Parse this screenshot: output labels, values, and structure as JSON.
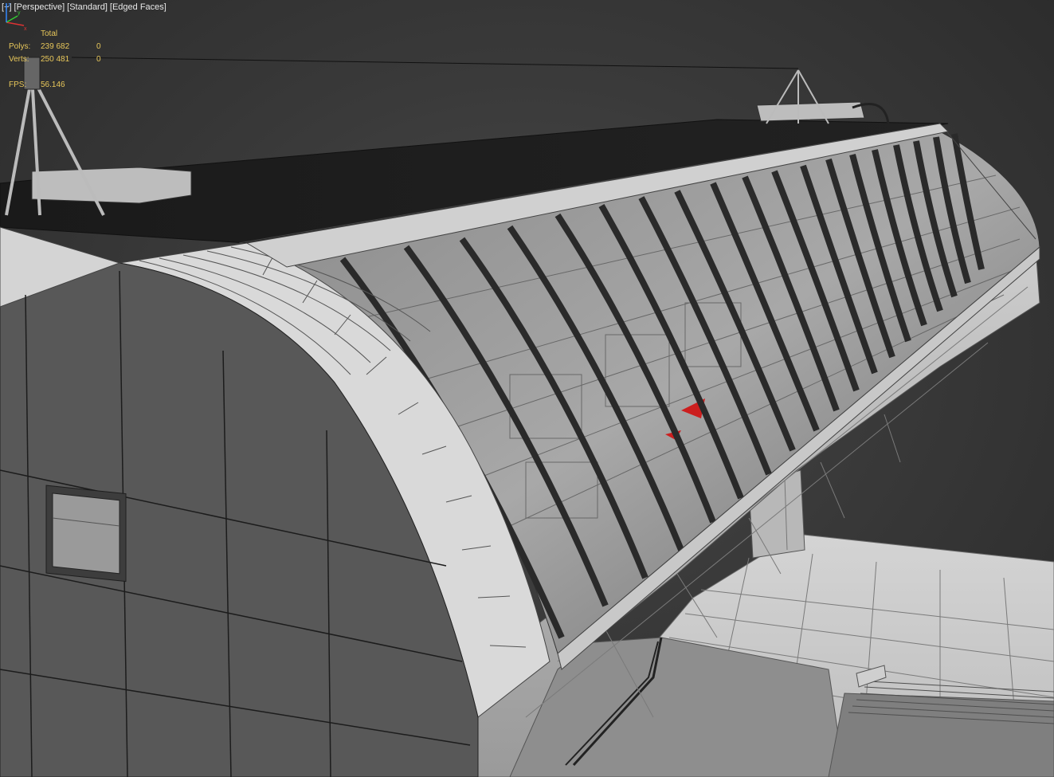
{
  "viewport": {
    "labels": [
      "[+]",
      "[Perspective]",
      "[Standard]",
      "[Edged Faces]"
    ]
  },
  "stats": {
    "header": "Total",
    "rows": [
      {
        "label": "Polys:",
        "total": "239 682",
        "selected": "0"
      },
      {
        "label": "Verts:",
        "total": "250 481",
        "selected": "0"
      }
    ],
    "fps_label": "FPS:",
    "fps_value": "56.146"
  },
  "colors": {
    "stats_text": "#e8c75a",
    "label_text": "#e8e8e8",
    "background": "#3a3a3a",
    "wall": "#585858",
    "roof": "#1d1d1d",
    "panel": "#cfcfcf",
    "glass_rib": "#2a2a2a",
    "accent_red": "#cc1f1f"
  },
  "axis": {
    "x": "x",
    "y": "y",
    "z": "z"
  }
}
